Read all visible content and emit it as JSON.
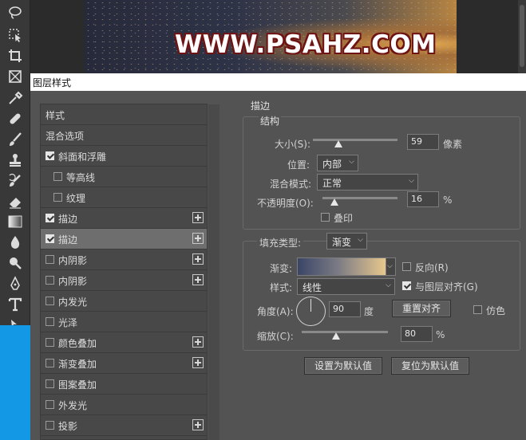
{
  "canvas": {
    "watermark": "WWW.PSAHZ.COM"
  },
  "dialog": {
    "title": "图层样式"
  },
  "style_list": {
    "header_styles": "样式",
    "header_blend": "混合选项",
    "items": [
      {
        "label": "斜面和浮雕",
        "checked": true,
        "plus": false,
        "selected": false,
        "sub": false
      },
      {
        "label": "等高线",
        "checked": false,
        "plus": false,
        "selected": false,
        "sub": true
      },
      {
        "label": "纹理",
        "checked": false,
        "plus": false,
        "selected": false,
        "sub": true
      },
      {
        "label": "描边",
        "checked": true,
        "plus": true,
        "selected": false,
        "sub": false
      },
      {
        "label": "描边",
        "checked": true,
        "plus": true,
        "selected": true,
        "sub": false
      },
      {
        "label": "内阴影",
        "checked": false,
        "plus": true,
        "selected": false,
        "sub": false
      },
      {
        "label": "内阴影",
        "checked": false,
        "plus": true,
        "selected": false,
        "sub": false
      },
      {
        "label": "内发光",
        "checked": false,
        "plus": false,
        "selected": false,
        "sub": false
      },
      {
        "label": "光泽",
        "checked": false,
        "plus": false,
        "selected": false,
        "sub": false
      },
      {
        "label": "颜色叠加",
        "checked": false,
        "plus": true,
        "selected": false,
        "sub": false
      },
      {
        "label": "渐变叠加",
        "checked": false,
        "plus": true,
        "selected": false,
        "sub": false
      },
      {
        "label": "图案叠加",
        "checked": false,
        "plus": false,
        "selected": false,
        "sub": false
      },
      {
        "label": "外发光",
        "checked": false,
        "plus": false,
        "selected": false,
        "sub": false
      },
      {
        "label": "投影",
        "checked": false,
        "plus": true,
        "selected": false,
        "sub": false
      }
    ]
  },
  "stroke": {
    "section_title": "描边",
    "structure_title": "结构",
    "size_label": "大小(S):",
    "size_value": "59",
    "size_unit": "像素",
    "size_level": 0.3,
    "position_label": "位置:",
    "position_value": "内部",
    "blend_label": "混合模式:",
    "blend_value": "正常",
    "opacity_label": "不透明度(O):",
    "opacity_value": "16",
    "opacity_unit": "%",
    "opacity_level": 0.16,
    "overprint_label": "叠印",
    "fill_type_label": "填充类型:",
    "fill_type_value": "渐变",
    "gradient_label": "渐变:",
    "reverse_label": "反向(R)",
    "style_label": "样式:",
    "style_value": "线性",
    "align_label": "与图层对齐(G)",
    "angle_label": "角度(A):",
    "angle_value": "90",
    "angle_unit": "度",
    "reset_align_button": "重置对齐",
    "dither_label": "仿色",
    "scale_label": "缩放(C):",
    "scale_value": "80",
    "scale_unit": "%",
    "scale_level": 0.4
  },
  "buttons": {
    "set_default": "设置为默认值",
    "reset_default": "复位为默认值"
  }
}
